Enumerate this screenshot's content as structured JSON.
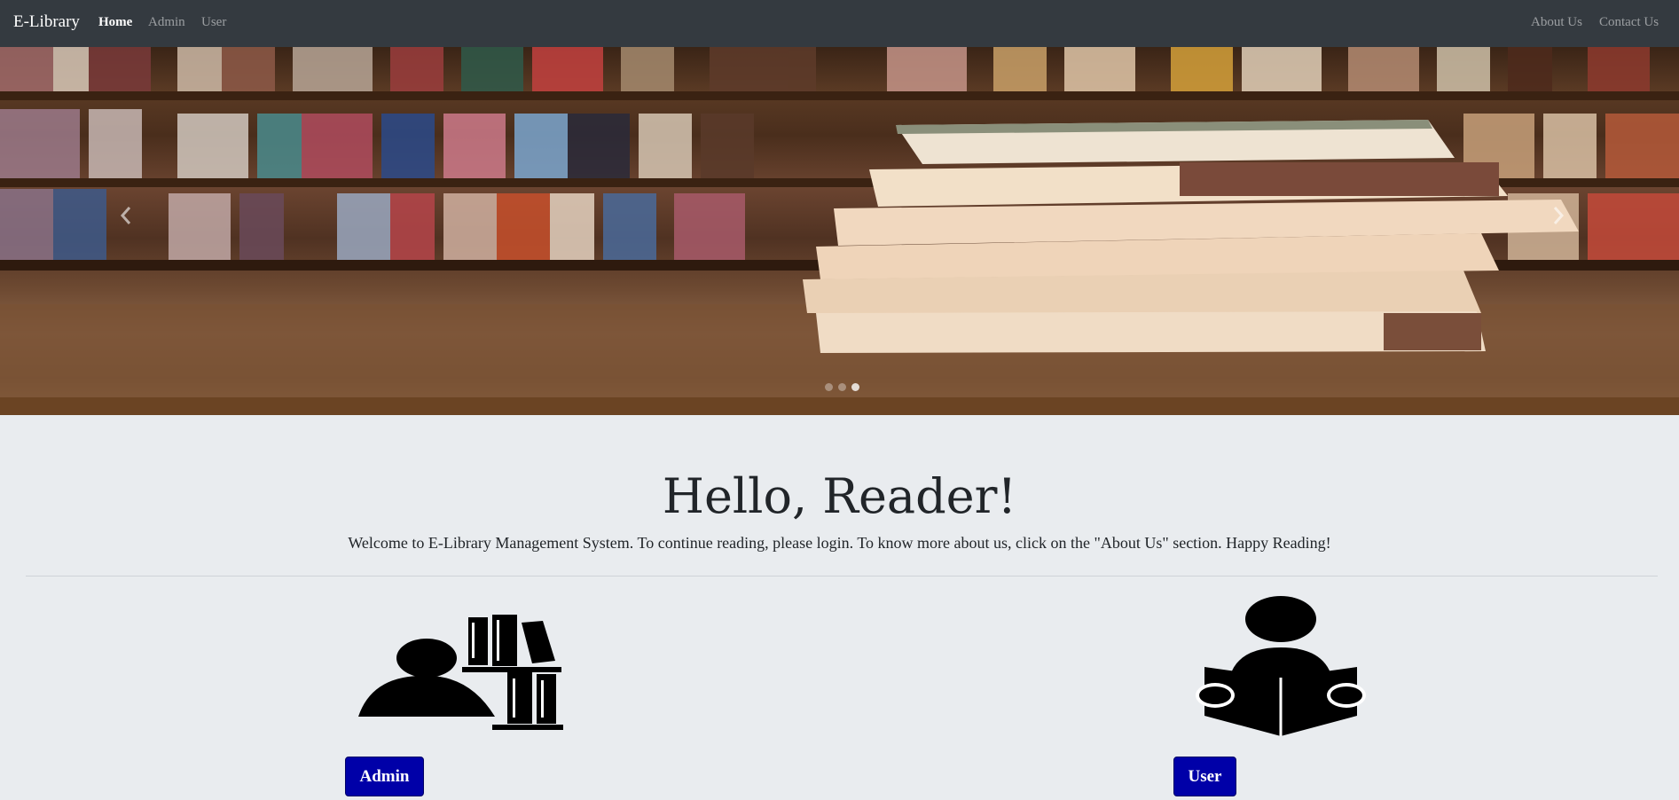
{
  "navbar": {
    "brand": "E-Library",
    "left_links": [
      "Home",
      "Admin",
      "User"
    ],
    "right_links": [
      "About Us",
      "Contact Us"
    ]
  },
  "carousel": {
    "indicators": 3,
    "active_indicator": 3,
    "prev_icon": "chevron-left-icon",
    "next_icon": "chevron-right-icon"
  },
  "jumbotron": {
    "heading": "Hello, Reader!",
    "lead": "Welcome to E-Library Management System. To continue reading, please login. To know more about us, click on the \"About Us\" section. Happy Reading!"
  },
  "cards": {
    "admin": {
      "icon": "librarian-icon",
      "button": "Admin"
    },
    "user": {
      "icon": "reader-icon",
      "button": "User"
    }
  },
  "colors": {
    "navbar": "#343a40",
    "page_bg": "#e9ecef",
    "button": "#0000a8"
  }
}
